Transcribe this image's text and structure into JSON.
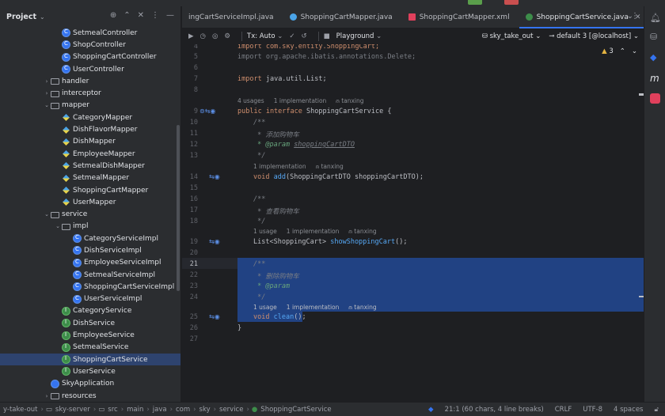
{
  "project_panel": {
    "title": "Project",
    "items": [
      {
        "label": "SetmealController",
        "type": "class",
        "indent": 5,
        "selected": false
      },
      {
        "label": "ShopController",
        "type": "class",
        "indent": 5,
        "selected": false
      },
      {
        "label": "ShoppingCartController",
        "type": "class",
        "indent": 5,
        "selected": false
      },
      {
        "label": "UserController",
        "type": "class",
        "indent": 5,
        "selected": false
      },
      {
        "label": "handler",
        "type": "folder",
        "indent": 4,
        "arrow": "›",
        "selected": false
      },
      {
        "label": "interceptor",
        "type": "folder",
        "indent": 4,
        "arrow": "›",
        "selected": false
      },
      {
        "label": "mapper",
        "type": "folder",
        "indent": 4,
        "arrow": "⌄",
        "selected": false
      },
      {
        "label": "CategoryMapper",
        "type": "xml",
        "indent": 5,
        "selected": false
      },
      {
        "label": "DishFlavorMapper",
        "type": "xml",
        "indent": 5,
        "selected": false
      },
      {
        "label": "DishMapper",
        "type": "xml",
        "indent": 5,
        "selected": false
      },
      {
        "label": "EmployeeMapper",
        "type": "xml",
        "indent": 5,
        "selected": false
      },
      {
        "label": "SetmealDishMapper",
        "type": "xml",
        "indent": 5,
        "selected": false
      },
      {
        "label": "SetmealMapper",
        "type": "xml",
        "indent": 5,
        "selected": false
      },
      {
        "label": "ShoppingCartMapper",
        "type": "xml",
        "indent": 5,
        "selected": false
      },
      {
        "label": "UserMapper",
        "type": "xml",
        "indent": 5,
        "selected": false
      },
      {
        "label": "service",
        "type": "folder",
        "indent": 4,
        "arrow": "⌄",
        "selected": false
      },
      {
        "label": "impl",
        "type": "folder",
        "indent": 5,
        "arrow": "⌄",
        "selected": false
      },
      {
        "label": "CategoryServiceImpl",
        "type": "class",
        "indent": 6,
        "selected": false
      },
      {
        "label": "DishServiceImpl",
        "type": "class",
        "indent": 6,
        "selected": false
      },
      {
        "label": "EmployeeServiceImpl",
        "type": "class",
        "indent": 6,
        "selected": false
      },
      {
        "label": "SetmealServiceImpl",
        "type": "class",
        "indent": 6,
        "selected": false
      },
      {
        "label": "ShoppingCartServiceImpl",
        "type": "class",
        "indent": 6,
        "selected": false
      },
      {
        "label": "UserServiceImpl",
        "type": "class",
        "indent": 6,
        "selected": false
      },
      {
        "label": "CategoryService",
        "type": "iface",
        "indent": 5,
        "selected": false
      },
      {
        "label": "DishService",
        "type": "iface",
        "indent": 5,
        "selected": false
      },
      {
        "label": "EmployeeService",
        "type": "iface",
        "indent": 5,
        "selected": false
      },
      {
        "label": "SetmealService",
        "type": "iface",
        "indent": 5,
        "selected": false
      },
      {
        "label": "ShoppingCartService",
        "type": "iface",
        "indent": 5,
        "selected": true
      },
      {
        "label": "UserService",
        "type": "iface",
        "indent": 5,
        "selected": false
      },
      {
        "label": "SkyApplication",
        "type": "app",
        "indent": 4,
        "selected": false
      },
      {
        "label": "resources",
        "type": "folder",
        "indent": 4,
        "arrow": "›",
        "selected": false
      }
    ]
  },
  "tabs": [
    {
      "label": "ingCartServiceImpl.java",
      "icon": "class",
      "active": false
    },
    {
      "label": "ShoppingCartMapper.java",
      "icon": "xml",
      "active": false
    },
    {
      "label": "ShoppingCartMapper.xml",
      "icon": "xmlfile",
      "active": false
    },
    {
      "label": "ShoppingCartService.java",
      "icon": "iface",
      "active": true
    }
  ],
  "toolbar": {
    "tx_label": "Tx: Auto",
    "playground_label": "Playground",
    "datasource": "sky_take_out",
    "session": "default 3 [@localhost]"
  },
  "inspection": {
    "warnings": "3"
  },
  "editor": {
    "line_numbers": [
      "4",
      "5",
      "6",
      "7",
      "",
      "8",
      "",
      "9",
      "10",
      "11",
      "12",
      "13",
      "",
      "14",
      "15",
      "16",
      "17",
      "18",
      "",
      "19",
      "20",
      "21",
      "22",
      "23",
      "24",
      "",
      "25",
      "26",
      "27"
    ],
    "hints": {
      "usages_impl_author": {
        "usages": "4 usages",
        "impl": "1 implementation",
        "author": "tanxing"
      },
      "impl_author_1": {
        "impl": "1 implementation",
        "author": "tanxing"
      },
      "usage_impl_author_2": {
        "usages": "1 usage",
        "impl": "1 implementation",
        "author": "tanxing"
      },
      "usage_impl_author_3": {
        "usages": "1 usage",
        "impl": "1 implementation",
        "author": "tanxing"
      }
    },
    "code": {
      "l4": "import com.sky.entity.ShoppingCart;",
      "l5": "import org.apache.ibatis.annotations.Delete;",
      "l7_kw": "import",
      "l7_rest": " java.util.List;",
      "l9_kw": "public interface",
      "l9_name": " ShoppingCartService {",
      "l10": "/**",
      "l11": " * 添加购物车",
      "l12_tag": " * @param",
      "l12_val": "shoppingCartDTO",
      "l13": " */",
      "l14_kw": "void",
      "l14_fn": "add",
      "l14_rest": "(ShoppingCartDTO shoppingCartDTO);",
      "l16": "/**",
      "l17": " * 查看购物车",
      "l18": " */",
      "l19_pre": "List<ShoppingCart> ",
      "l19_fn": "showShoppingCart",
      "l19_rest": "();",
      "l21": "/**",
      "l22": " * 删除购物车",
      "l23_tag": " * @param",
      "l24": " */",
      "l25_kw": "void",
      "l25_fn": "clean",
      "l25_rest": "();",
      "l27": "}"
    }
  },
  "status_bar": {
    "breadcrumbs": [
      "y-take-out",
      "sky-server",
      "src",
      "main",
      "java",
      "com",
      "sky",
      "service",
      "ShoppingCartService"
    ],
    "position": "21:1 (60 chars, 4 line breaks)",
    "line_sep": "CRLF",
    "encoding": "UTF-8",
    "indent": "4 spaces"
  }
}
